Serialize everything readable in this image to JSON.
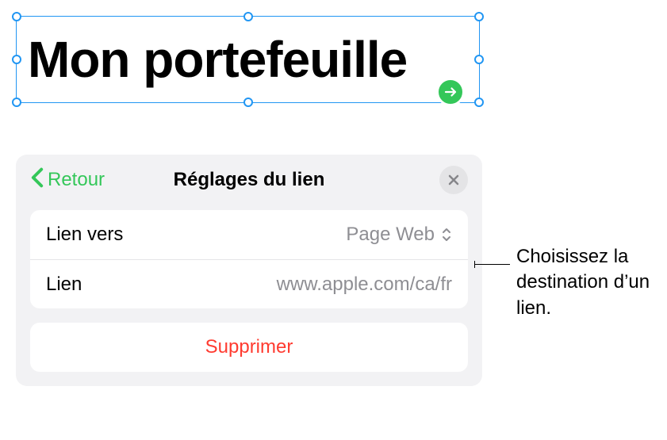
{
  "canvas": {
    "title_text": "Mon portefeuille"
  },
  "popover": {
    "back_label": "Retour",
    "title": "Réglages du lien",
    "link_to": {
      "label": "Lien vers",
      "value": "Page Web"
    },
    "link_url": {
      "label": "Lien",
      "value": "www.apple.com/ca/fr"
    },
    "delete_label": "Supprimer"
  },
  "callout": {
    "text": "Choisissez la destination d’un lien."
  },
  "colors": {
    "accent_green": "#34C759",
    "destructive_red": "#ff3b30",
    "selection_blue": "#2196F3"
  }
}
